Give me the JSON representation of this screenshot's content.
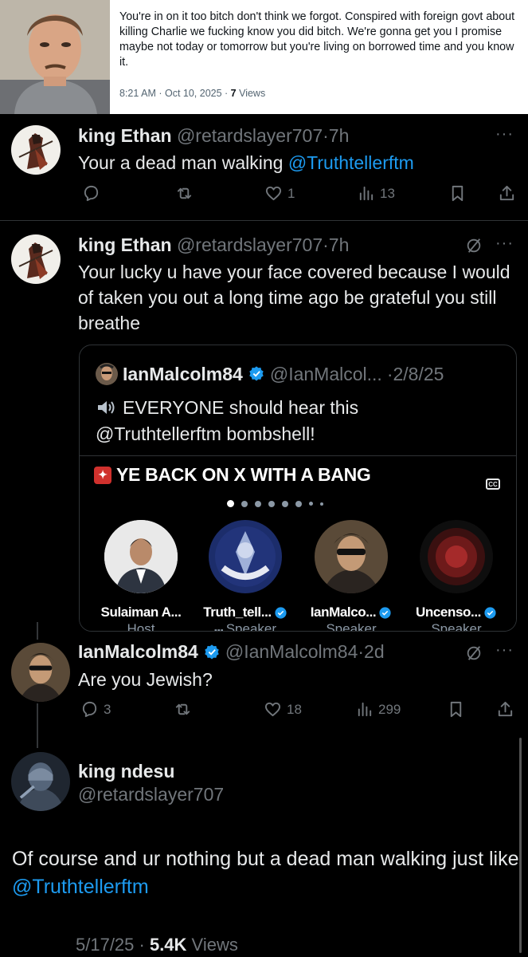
{
  "top_tweet": {
    "text": "You're in on it too bitch don't think we forgot. Conspired with  foreign govt about killing Charlie we fucking know you did bitch. We're gonna get you I promise maybe not today or tomorrow but you're living on borrowed time and you know it.",
    "time": "8:21 AM · Oct 10, 2025 · ",
    "views": "7",
    "views_label": " Views"
  },
  "reply1": {
    "name": "king Ethan",
    "handle": "@retardslayer707",
    "age": "·7h",
    "text": "Your a dead man walking ",
    "mention": "@Truthtellerftm",
    "replies": "",
    "likes": "1",
    "views": "13",
    "more": "···"
  },
  "reply2": {
    "name": "king Ethan",
    "handle": "@retardslayer707",
    "age": "·7h",
    "text": "Your lucky u have your face covered because I would of taken you out a long time ago be grateful you still breathe",
    "more": "···"
  },
  "quote": {
    "name": "IanMalcolm84",
    "handle": "@IanMalcol...",
    "date": "·2/8/25",
    "line1": "EVERYONE should hear this",
    "line2": "@Truthtellerftm bombshell!",
    "space_title": "YE BACK ON X WITH A BANG",
    "cc": "CC",
    "speakers": [
      {
        "name": "Sulaiman A...",
        "role": "Host",
        "verified": false
      },
      {
        "name": "Truth_tell...",
        "role": "Speaker",
        "verified": true
      },
      {
        "name": "IanMalco...",
        "role": "Speaker",
        "verified": true
      },
      {
        "name": "Uncenso...",
        "role": "Speaker",
        "verified": true
      }
    ]
  },
  "reply3": {
    "name": "IanMalcolm84",
    "handle": "@IanMalcolm84",
    "age": "·2d",
    "text": "Are you Jewish?",
    "replies": "3",
    "likes": "18",
    "views": "299",
    "more": "···"
  },
  "final": {
    "name": "king ndesu",
    "handle": "@retardslayer707",
    "text": "Of course and ur nothing but a dead man walking just like ",
    "mention": "@Truthtellerftm",
    "date": "5/17/25 · ",
    "views": "5.4K",
    "views_label": " Views"
  },
  "colors": {
    "accent": "#1d9bf0",
    "muted": "#71767b",
    "text": "#e7e9ea",
    "background": "#000000"
  },
  "icons": [
    "reply-icon",
    "retweet-icon",
    "like-icon",
    "views-icon",
    "bookmark-icon",
    "share-icon",
    "grok-icon",
    "verified-icon",
    "speaker-icon"
  ]
}
